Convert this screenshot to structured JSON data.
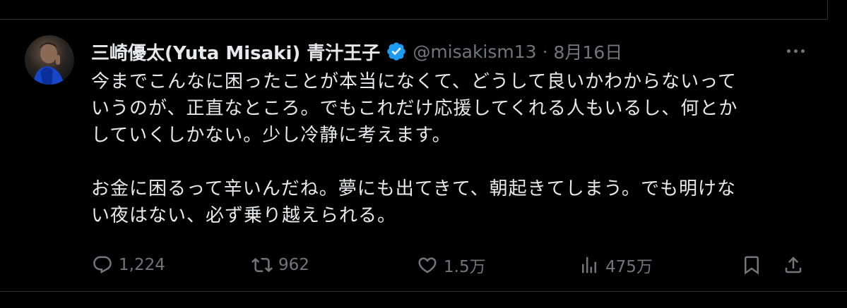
{
  "tweet": {
    "display_name": "三崎優太(Yuta Misaki) 青汁王子",
    "handle": "@misakism13",
    "separator": "·",
    "date": "8月16日",
    "text": "今までこんなに困ったことが本当になくて、どうして良いかわからないって\nいうのが、正直なところ。でもこれだけ応援してくれる人もいるし、何とか\nしていくしかない。少し冷静に考えます。\n\nお金に困るって辛いんだね。夢にも出てきて、朝起きてしまう。でも明けな\nい夜はない、必ず乗り越えられる。",
    "verified_color": "#1d9bf0",
    "icons": {
      "more": "more-icon",
      "verified": "verified-badge-icon"
    }
  },
  "actions": {
    "reply": {
      "icon": "reply-icon",
      "count": "1,224"
    },
    "retweet": {
      "icon": "retweet-icon",
      "count": "962"
    },
    "like": {
      "icon": "heart-icon",
      "count": "1.5万"
    },
    "views": {
      "icon": "views-icon",
      "count": "475万"
    },
    "bookmark": {
      "icon": "bookmark-icon"
    },
    "share": {
      "icon": "share-icon"
    }
  },
  "colors": {
    "background": "#000000",
    "text": "#e7e9ea",
    "muted": "#71767b",
    "border": "#2f3336"
  }
}
